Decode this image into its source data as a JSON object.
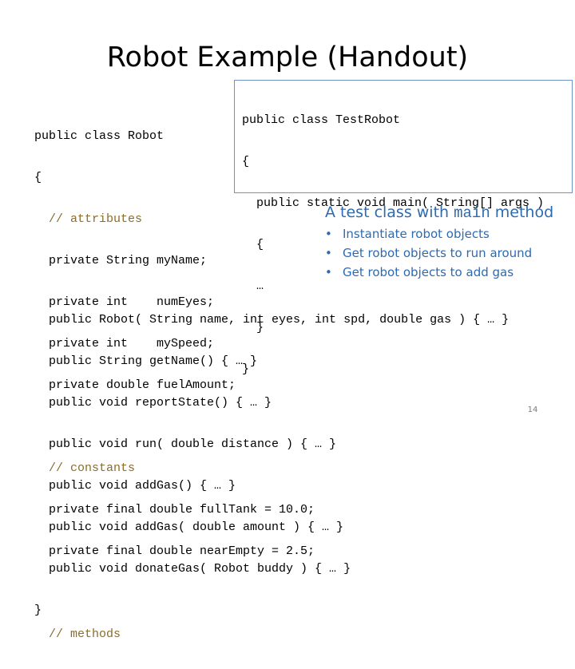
{
  "slide": {
    "title": "Robot Example (Handout)",
    "page_number": "14"
  },
  "robot_code": {
    "top_lines": [
      {
        "text": "public class Robot",
        "kind": "code"
      },
      {
        "text": "{",
        "kind": "code"
      },
      {
        "text": "  // attributes",
        "kind": "comment"
      },
      {
        "text": "  private String myName;",
        "kind": "code"
      },
      {
        "text": "  private int    numEyes;",
        "kind": "code"
      },
      {
        "text": "  private int    mySpeed;",
        "kind": "code"
      },
      {
        "text": "  private double fuelAmount;",
        "kind": "code"
      },
      {
        "text": "",
        "kind": "code"
      },
      {
        "text": "  // constants",
        "kind": "comment"
      },
      {
        "text": "  private final double fullTank = 10.0;",
        "kind": "code"
      },
      {
        "text": "  private final double nearEmpty = 2.5;",
        "kind": "code"
      },
      {
        "text": "",
        "kind": "code"
      },
      {
        "text": "  // methods",
        "kind": "comment"
      }
    ],
    "bottom_lines": [
      {
        "text": "  public Robot( String name, int eyes, int spd, double gas ) { … }",
        "kind": "code"
      },
      {
        "text": "  public String getName() { … }",
        "kind": "code"
      },
      {
        "text": "  public void reportState() { … }",
        "kind": "code"
      },
      {
        "text": "  public void run( double distance ) { … }",
        "kind": "code"
      },
      {
        "text": "  public void addGas() { … }",
        "kind": "code"
      },
      {
        "text": "  public void addGas( double amount ) { … }",
        "kind": "code"
      },
      {
        "text": "  public void donateGas( Robot buddy ) { … }",
        "kind": "code"
      },
      {
        "text": "}",
        "kind": "code"
      }
    ]
  },
  "test_robot_code": {
    "lines": [
      "public class TestRobot",
      "{",
      "  public static void main( String[] args )",
      "  {",
      "  …",
      "  }",
      "}"
    ]
  },
  "callout": {
    "heading_prefix": "A test class with ",
    "heading_code": "main",
    "heading_suffix": " method",
    "bullet_symbol": "•",
    "bullets": [
      "Instantiate robot objects",
      "Get robot objects to run around",
      "Get robot objects to add gas"
    ]
  },
  "colors": {
    "comment": "#8a6d2b",
    "callout_text": "#2e6ab0",
    "box_border": "#6f93c4"
  }
}
